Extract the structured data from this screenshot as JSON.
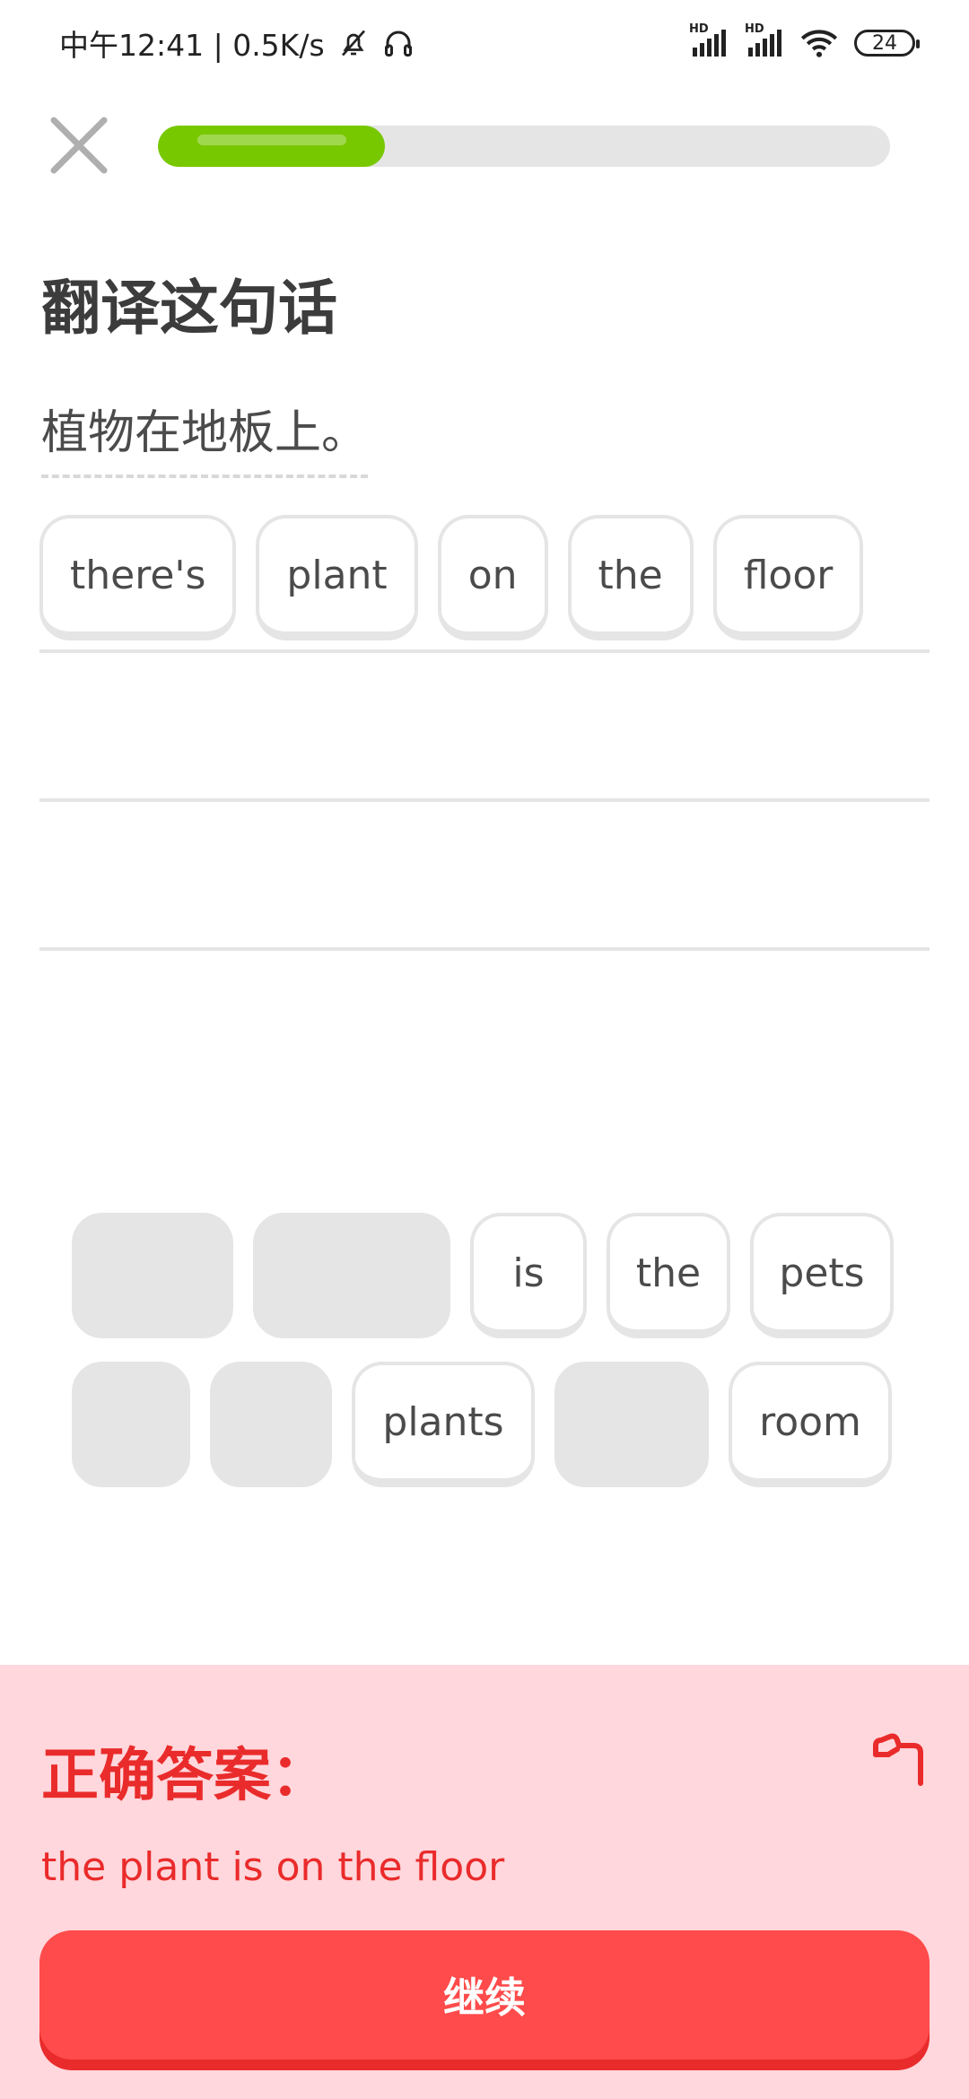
{
  "status_bar": {
    "left_text": "中午12:41 | 0.5K/s",
    "signal_label_1": "HD",
    "signal_label_2": "HD",
    "battery": "24",
    "icons": [
      "bell-off-icon",
      "headphones-icon",
      "signal-icon",
      "signal-icon",
      "wifi-icon",
      "battery-icon"
    ]
  },
  "lesson": {
    "progress": 0.31,
    "title": "翻译这句话",
    "prompt": "植物在地板上。"
  },
  "answer_words": [
    "there's",
    "plant",
    "on",
    "the",
    "floor"
  ],
  "word_bank": {
    "row1": [
      {
        "label": "",
        "used": true
      },
      {
        "label": "",
        "used": true
      },
      {
        "label": "is",
        "used": false
      },
      {
        "label": "the",
        "used": false
      },
      {
        "label": "pets",
        "used": false
      }
    ],
    "row2": [
      {
        "label": "",
        "used": true
      },
      {
        "label": "",
        "used": true
      },
      {
        "label": "plants",
        "used": false
      },
      {
        "label": "",
        "used": true
      },
      {
        "label": "room",
        "used": false
      }
    ]
  },
  "feedback": {
    "heading": "正确答案：",
    "answer": "the plant is on the floor",
    "continue_label": "继续"
  },
  "colors": {
    "progress_green": "#78c800",
    "error_red": "#ea2b2b",
    "button_red": "#ff4b4b",
    "footer_bg": "#ffd7dc"
  }
}
